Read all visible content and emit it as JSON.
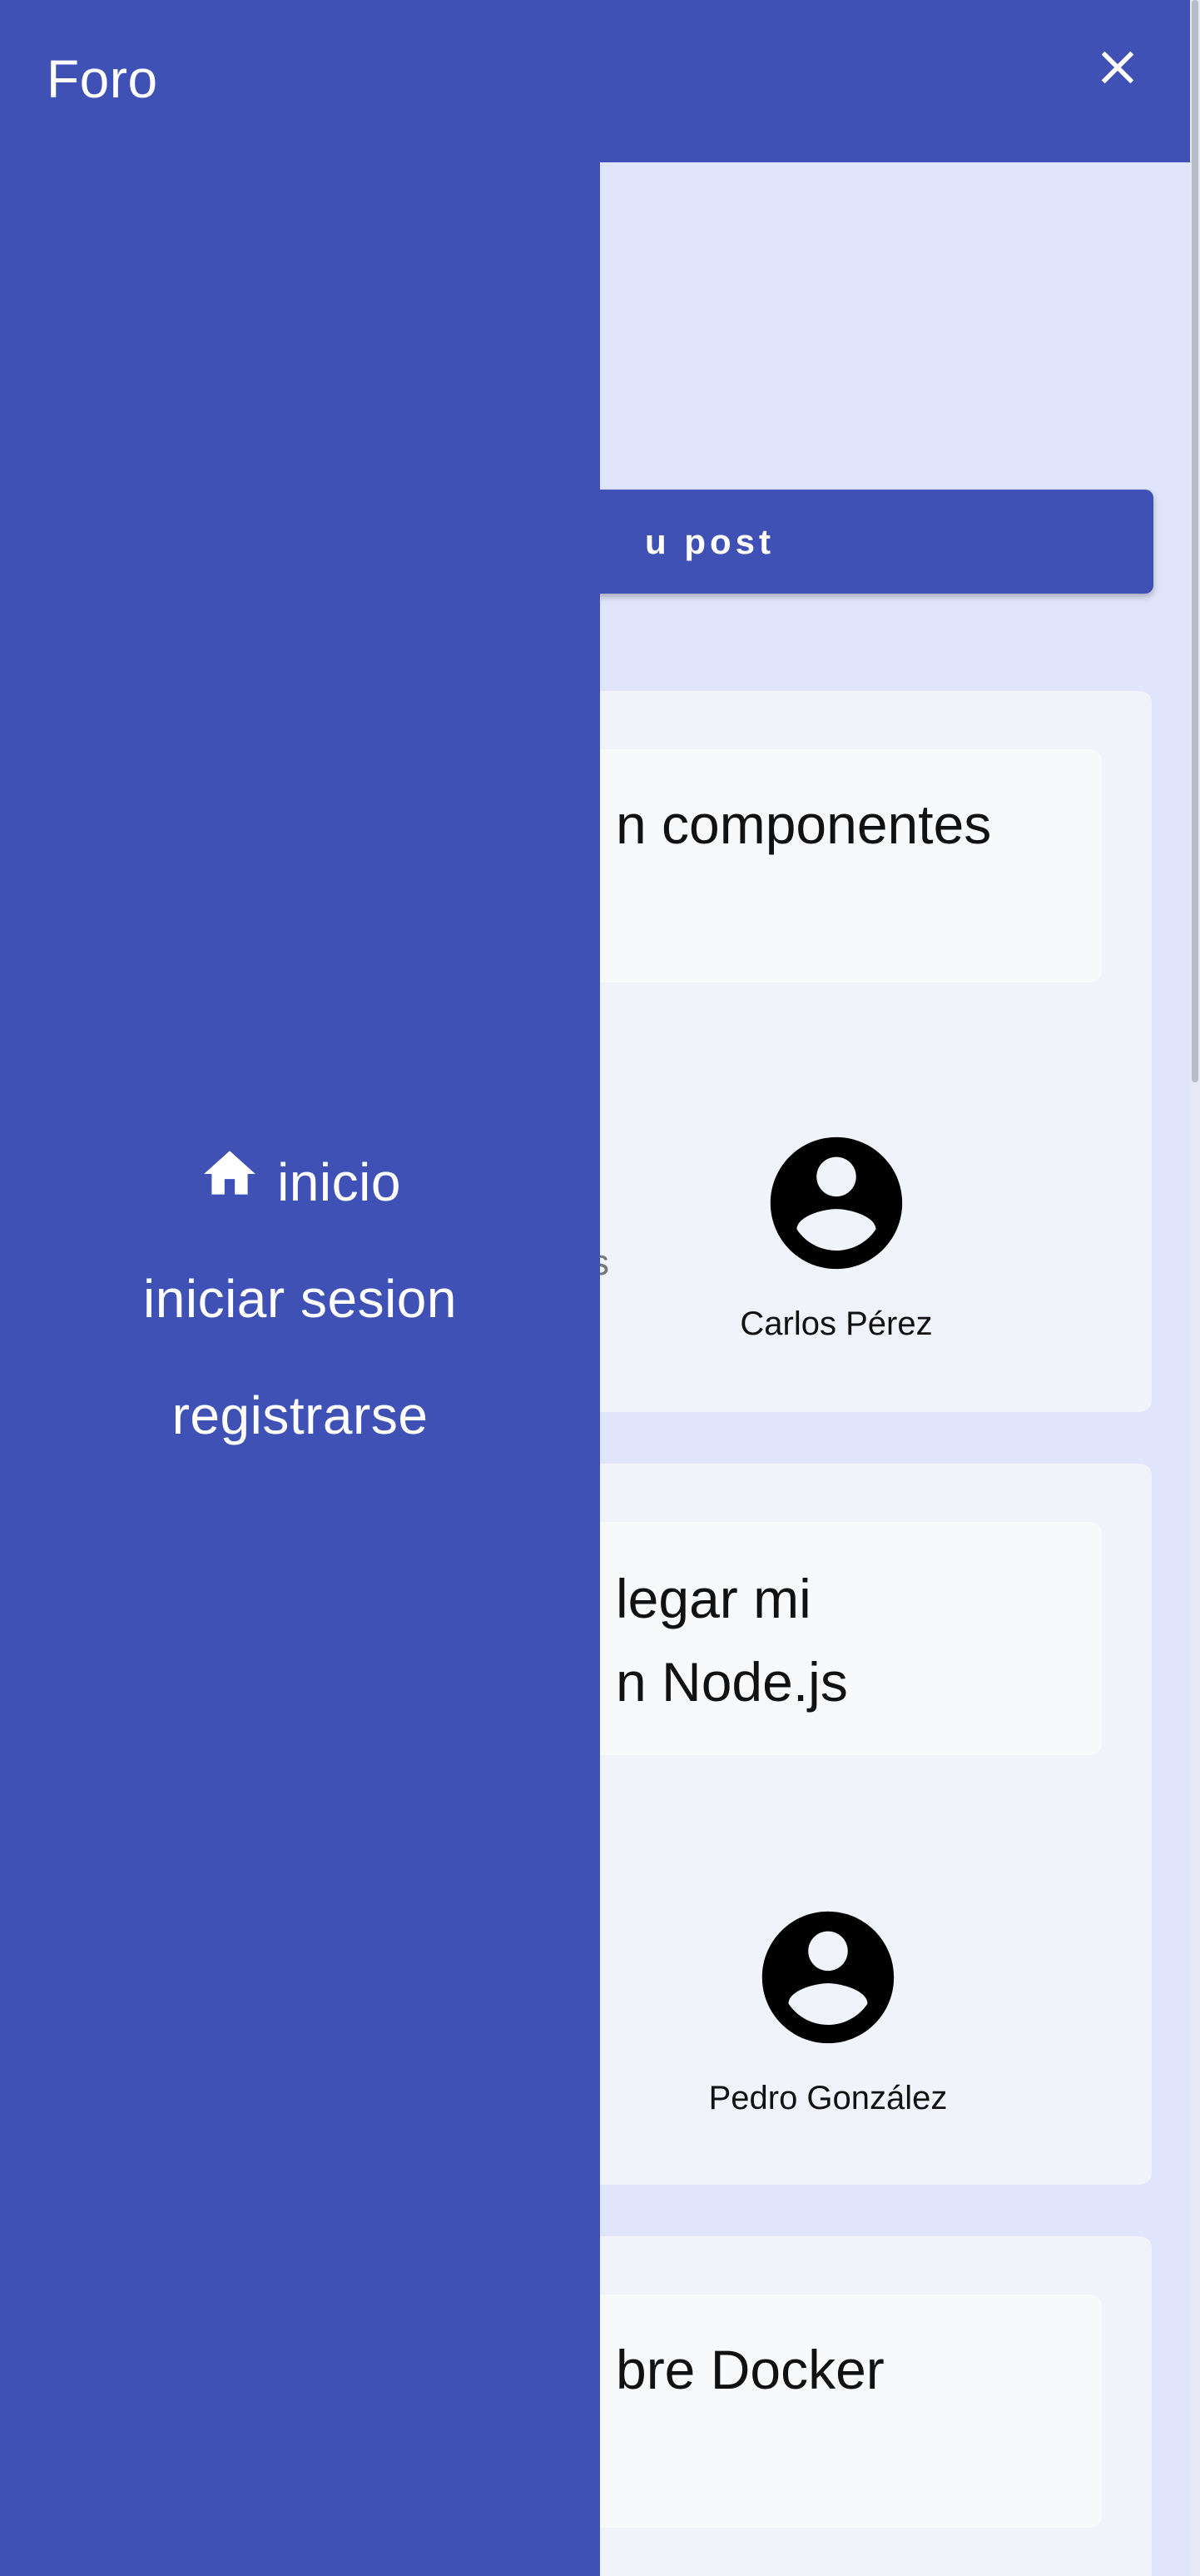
{
  "app": {
    "title": "Foro",
    "close_icon": "close-icon"
  },
  "colors": {
    "primary": "#3f51b5",
    "background": "#e1e5fb",
    "card": "#f0f3f9",
    "tag_green": "#4ade80"
  },
  "drawer": {
    "items": [
      {
        "label": "inicio",
        "icon": "home-icon"
      },
      {
        "label": "iniciar sesion"
      },
      {
        "label": "registrarse"
      }
    ]
  },
  "main": {
    "create_post_label": "u post",
    "posts": [
      {
        "title_visible": "n componentes",
        "side_label": "s",
        "author": "Carlos Pérez",
        "avatar_icon": "account-circle-icon"
      },
      {
        "title_visible": "legar mi\nn Node.js",
        "author": "Pedro González",
        "avatar_icon": "account-circle-icon"
      },
      {
        "title_visible": "bre Docker"
      }
    ]
  }
}
